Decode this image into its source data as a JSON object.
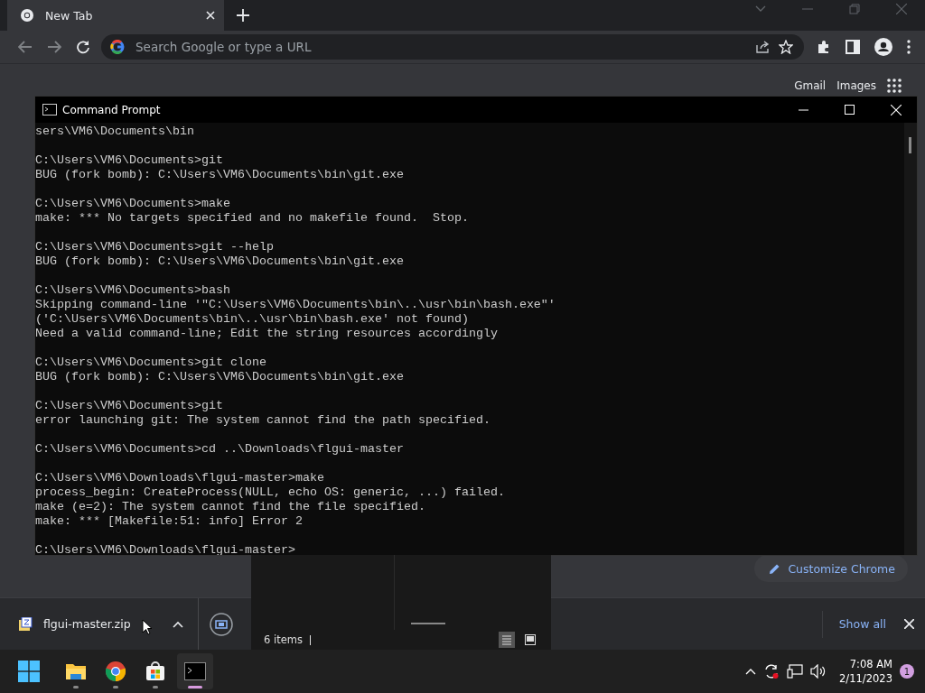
{
  "browser": {
    "tab": {
      "title": "New Tab",
      "selected": true
    },
    "address": {
      "placeholder": "Search Google or type a URL"
    },
    "top_links": [
      "Gmail",
      "Images"
    ],
    "customize_button": "Customize Chrome"
  },
  "terminal": {
    "title": "Command Prompt",
    "blocks": [
      [
        "sers\\VM6\\Documents\\bin"
      ],
      [
        "C:\\Users\\VM6\\Documents>git",
        "BUG (fork bomb): C:\\Users\\VM6\\Documents\\bin\\git.exe"
      ],
      [
        "C:\\Users\\VM6\\Documents>make",
        "make: *** No targets specified and no makefile found.  Stop."
      ],
      [
        "C:\\Users\\VM6\\Documents>git --help",
        "BUG (fork bomb): C:\\Users\\VM6\\Documents\\bin\\git.exe"
      ],
      [
        "C:\\Users\\VM6\\Documents>bash",
        "Skipping command-line '\"C:\\Users\\VM6\\Documents\\bin\\..\\usr\\bin\\bash.exe\"'",
        "('C:\\Users\\VM6\\Documents\\bin\\..\\usr\\bin\\bash.exe' not found)",
        "Need a valid command-line; Edit the string resources accordingly"
      ],
      [
        "C:\\Users\\VM6\\Documents>git clone",
        "BUG (fork bomb): C:\\Users\\VM6\\Documents\\bin\\git.exe"
      ],
      [
        "C:\\Users\\VM6\\Documents>git",
        "error launching git: The system cannot find the path specified."
      ],
      [
        "C:\\Users\\VM6\\Documents>cd ..\\Downloads\\flgui-master"
      ],
      [
        "C:\\Users\\VM6\\Downloads\\flgui-master>make",
        "process_begin: CreateProcess(NULL, echo OS: generic, ...) failed.",
        "make (e=2): The system cannot find the file specified.",
        "make: *** [Makefile:51: info] Error 2"
      ],
      [
        "C:\\Users\\VM6\\Downloads\\flgui-master>"
      ]
    ]
  },
  "explorer": {
    "status": "6 items",
    "views": [
      {
        "kind": "details",
        "selected": true
      },
      {
        "kind": "tiles",
        "selected": false
      }
    ]
  },
  "downloads": {
    "file": "flgui-master.zip",
    "show_all": "Show all"
  },
  "taskbar": {
    "apps": [
      {
        "kind": "files",
        "active": false
      },
      {
        "kind": "chrome",
        "active": false
      },
      {
        "kind": "store",
        "active": false
      },
      {
        "kind": "terminal",
        "active": true
      }
    ],
    "time": "7:08 AM",
    "date": "2/11/2023",
    "notifications": "1"
  }
}
